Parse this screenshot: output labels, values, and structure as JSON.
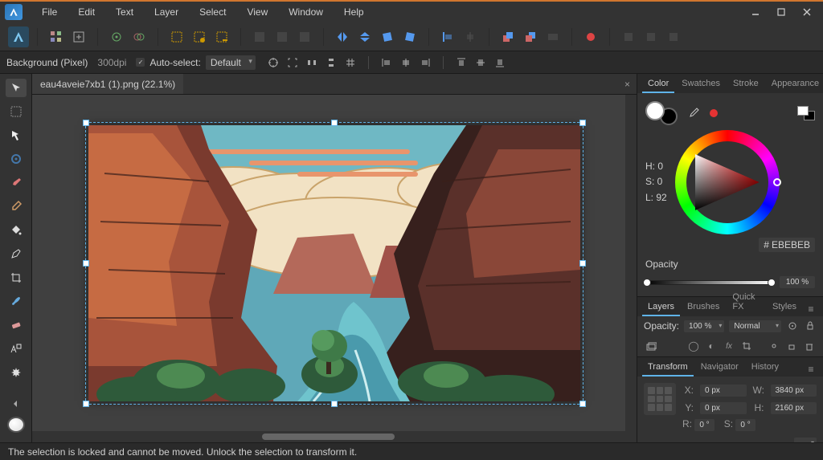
{
  "menu": {
    "items": [
      "File",
      "Edit",
      "Text",
      "Layer",
      "Select",
      "View",
      "Window",
      "Help"
    ]
  },
  "toolbar": {
    "groups": [
      [
        "app-icon"
      ],
      [
        "grid-btn1",
        "grid-btn2"
      ],
      [
        "target-btn",
        "double-target-btn"
      ],
      [
        "marquee-btn",
        "marquee-add-btn",
        "marquee-subtract-btn"
      ],
      [
        "dim1",
        "dim2",
        "dim3"
      ],
      [
        "flip-h-btn",
        "flip-v-btn",
        "rotate-ccw-btn",
        "rotate-cw-btn"
      ],
      [
        "align-1",
        "align-2"
      ],
      [
        "arrange-1",
        "arrange-2",
        "arrange-3"
      ],
      [
        "paint-btn"
      ],
      [
        "snap-1",
        "snap-2",
        "snap-3"
      ]
    ]
  },
  "context": {
    "layer_label": "Background (Pixel)",
    "dpi": "300dpi",
    "autoselect_label": "Auto-select:",
    "autoselect_value": "Default",
    "autoselect_checked": true,
    "icons": [
      "target",
      "corners",
      "distribute-h",
      "distribute-v",
      "grid",
      " ",
      "align-l",
      "align-c",
      "align-r",
      " ",
      "align-t",
      "align-m",
      "align-b"
    ]
  },
  "document": {
    "tab_title": "eau4aveie7xb1 (1).png (22.1%)"
  },
  "tools": [
    "move-tool",
    "view-tool",
    "artistic-text-tool",
    "node-tool",
    "color-picker-tool",
    "flood-fill-tool",
    "gradient-tool",
    "pen-tool",
    "crop-tool",
    "paint-brush-tool",
    "erase-tool",
    "clone-tool",
    "dodge-tool",
    "expand-tool"
  ],
  "color_panel": {
    "tabs": [
      "Color",
      "Swatches",
      "Stroke",
      "Appearance"
    ],
    "active_tab": "Color",
    "h": "H: 0",
    "s": "S: 0",
    "l": "L: 92",
    "hex_label": "EBEBEB",
    "hex_prefix": "#",
    "opacity_label": "Opacity",
    "opacity_value": "100 %"
  },
  "layers_panel": {
    "tabs": [
      "Layers",
      "Brushes",
      "Quick FX",
      "Styles"
    ],
    "active_tab": "Layers",
    "opacity_label": "Opacity:",
    "opacity_value": "100 %",
    "blend_mode": "Normal"
  },
  "transform_panel": {
    "tabs": [
      "Transform",
      "Navigator",
      "History"
    ],
    "active_tab": "Transform",
    "x_label": "X:",
    "x_value": "0 px",
    "y_label": "Y:",
    "y_value": "0 px",
    "w_label": "W:",
    "w_value": "3840 px",
    "h_label": "H:",
    "h_value": "2160 px",
    "r_label": "R:",
    "r_value": "0 °",
    "s_label": "S:",
    "s_value": "0 °"
  },
  "status": {
    "message": "The selection is locked and cannot be moved. Unlock the selection to transform it."
  },
  "canvas": {
    "handles": [
      [
        0,
        0
      ],
      [
        50,
        0
      ],
      [
        100,
        0
      ],
      [
        0,
        50
      ],
      [
        100,
        50
      ],
      [
        0,
        100
      ],
      [
        50,
        100
      ],
      [
        100,
        100
      ]
    ]
  }
}
